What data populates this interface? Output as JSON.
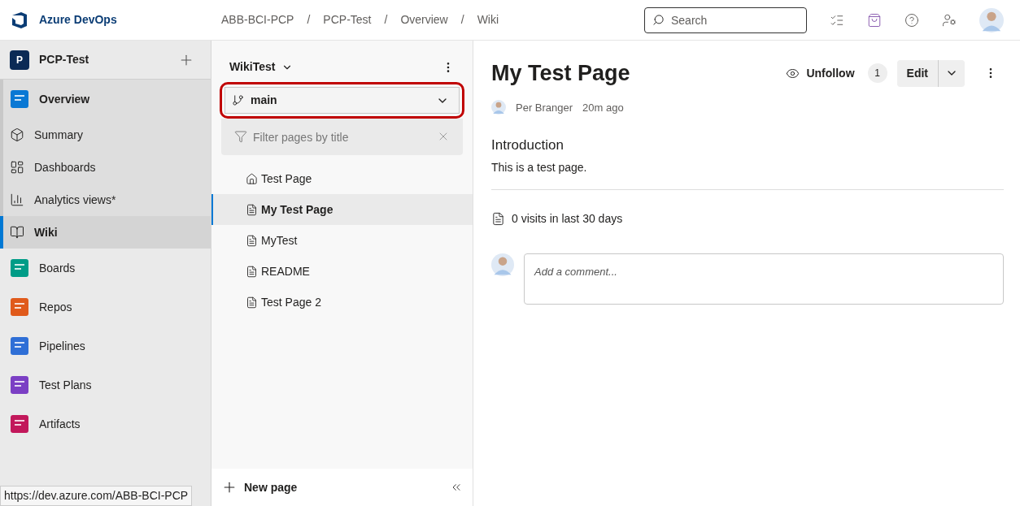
{
  "header": {
    "brand": "Azure DevOps",
    "breadcrumbs": [
      "ABB-BCI-PCP",
      "PCP-Test",
      "Overview",
      "Wiki"
    ],
    "separator": "/",
    "search": {
      "placeholder": "Search"
    }
  },
  "sidebar": {
    "project": {
      "initial": "P",
      "name": "PCP-Test"
    },
    "items": [
      {
        "label": "Overview",
        "kind": "hub",
        "selected": false
      },
      {
        "label": "Summary",
        "kind": "sub",
        "selected": false
      },
      {
        "label": "Dashboards",
        "kind": "sub",
        "selected": false
      },
      {
        "label": "Analytics views*",
        "kind": "sub",
        "selected": false
      },
      {
        "label": "Wiki",
        "kind": "sub",
        "selected": true
      },
      {
        "label": "Boards",
        "kind": "hub",
        "selected": false
      },
      {
        "label": "Repos",
        "kind": "hub",
        "selected": false
      },
      {
        "label": "Pipelines",
        "kind": "hub",
        "selected": false
      },
      {
        "label": "Test Plans",
        "kind": "hub",
        "selected": false
      },
      {
        "label": "Artifacts",
        "kind": "hub",
        "selected": false
      }
    ]
  },
  "wiki_panel": {
    "wiki_name": "WikiTest",
    "branch": {
      "name": "main",
      "highlighted": true
    },
    "filter": {
      "placeholder": "Filter pages by title"
    },
    "pages": [
      {
        "title": "Test Page",
        "kind": "home",
        "selected": false
      },
      {
        "title": "My Test Page",
        "kind": "page",
        "selected": true
      },
      {
        "title": "MyTest",
        "kind": "page",
        "selected": false
      },
      {
        "title": "README",
        "kind": "page",
        "selected": false
      },
      {
        "title": "Test Page 2",
        "kind": "page",
        "selected": false
      }
    ],
    "new_page": "New page"
  },
  "page": {
    "title": "My Test Page",
    "unfollow": "Unfollow",
    "followers": "1",
    "edit": "Edit",
    "author": "Per Branger",
    "time": "20m ago",
    "heading": "Introduction",
    "body": "This is a test page.",
    "visits": "0 visits in last 30 days",
    "comment": {
      "placeholder": "Add a comment..."
    }
  },
  "status_bar": {
    "url": "https://dev.azure.com/ABB-BCI-PCP"
  }
}
